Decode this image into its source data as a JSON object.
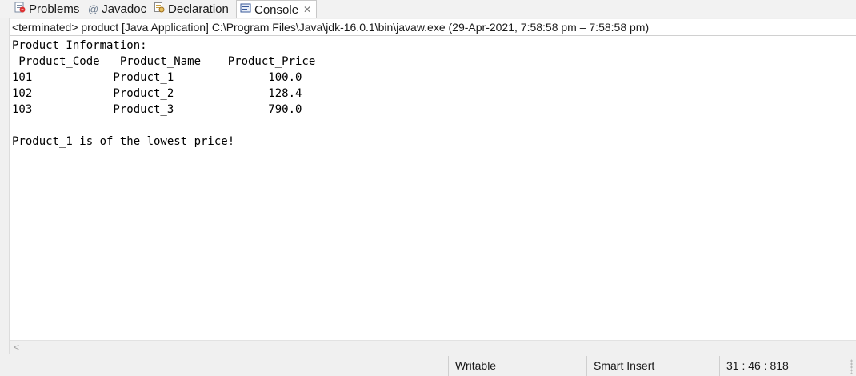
{
  "tabs": [
    {
      "label": "Problems",
      "icon": "problems-icon",
      "active": false
    },
    {
      "label": "Javadoc",
      "icon": "javadoc-icon",
      "active": false
    },
    {
      "label": "Declaration",
      "icon": "declaration-icon",
      "active": false
    },
    {
      "label": "Console",
      "icon": "console-icon",
      "active": true
    }
  ],
  "status_line": "<terminated> product [Java Application] C:\\Program Files\\Java\\jdk-16.0.1\\bin\\javaw.exe  (29-Apr-2021, 7:58:58 pm – 7:58:58 pm)",
  "console_output": [
    "Product Information:",
    " Product_Code   Product_Name    Product_Price",
    "101            Product_1              100.0",
    "102            Product_2              128.4",
    "103            Product_3              790.0",
    "",
    "Product_1 is of the lowest price!"
  ],
  "statusbar": {
    "mode": "Writable",
    "insert": "Smart Insert",
    "position": "31 : 46 : 818"
  }
}
